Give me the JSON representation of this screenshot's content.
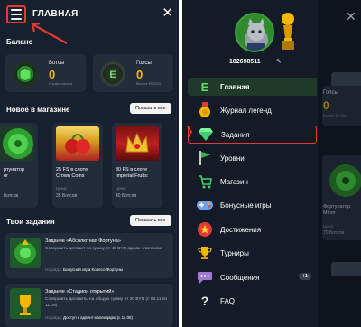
{
  "left": {
    "header": {
      "title": "ГЛАВНАЯ"
    },
    "balance": {
      "title": "Баланс",
      "cards": [
        {
          "label": "Ботсы",
          "value": "0",
          "sub": "Игровая валюта"
        },
        {
          "label": "Голсы",
          "value": "0",
          "sub": "Валюта ФК 2024"
        }
      ]
    },
    "new_in_store": {
      "title": "Новое в магазине",
      "show_all": "Показать все",
      "products": [
        {
          "name": "ртунатор\nor",
          "price_label": "",
          "price_value": "Ботсов"
        },
        {
          "name": "25 FS в слоте\nCrown Coins",
          "price_label": "Цена:",
          "price_value": "35 Ботсов"
        },
        {
          "name": "30 FS в слоте\nImperial Fruits:",
          "price_label": "Цена:",
          "price_value": "40 Ботсов"
        }
      ]
    },
    "tasks": {
      "title": "Твои задания",
      "show_all": "Показать все",
      "items": [
        {
          "title": "Задание «Абсолютная Фортуна»",
          "desc": "Совершить депозит на сумму от 40 BYN одним платежом.",
          "reward_label": "Награда:",
          "reward": "Бонусная игра Колесо Фортуны"
        },
        {
          "title": "Задание «Стадион открытий»",
          "desc": "Совершить депозиты на общую сумму от 30 BYN (с 08.11 по 11.06)",
          "reward_label": "Награда:",
          "reward": "Доступ к адвент-календарю (с 11.06)"
        }
      ]
    }
  },
  "right": {
    "user_id": "182698511",
    "menu": [
      {
        "label": "Главная",
        "icon": "home-e-icon",
        "active": true
      },
      {
        "label": "Журнал легенд",
        "icon": "medal-icon"
      },
      {
        "label": "Задания",
        "icon": "gem-icon",
        "highlight": true
      },
      {
        "label": "Уровни",
        "icon": "flag-icon"
      },
      {
        "label": "Магазин",
        "icon": "cart-icon"
      },
      {
        "label": "Бонусные игры",
        "icon": "gamepad-icon"
      },
      {
        "label": "Достижения",
        "icon": "star-badge-icon"
      },
      {
        "label": "Турниры",
        "icon": "trophy-icon"
      },
      {
        "label": "Сообщения",
        "icon": "chat-icon",
        "badge": "+1"
      },
      {
        "label": "FAQ",
        "icon": "question-icon"
      }
    ],
    "background": {
      "balance_label": "Голсы",
      "balance_value": "0",
      "balance_sub": "Валюта ФК 2024",
      "product_name": "Фортунатор\nMinor",
      "product_price_label": "Цена:",
      "product_price_value": "70 Ботсов"
    }
  },
  "colors": {
    "panel_bg": "#17202e",
    "card_bg": "#222c3b",
    "accent_yellow": "#f5b800",
    "highlight_red": "#e53935",
    "active_green": "#1f3a2a"
  }
}
